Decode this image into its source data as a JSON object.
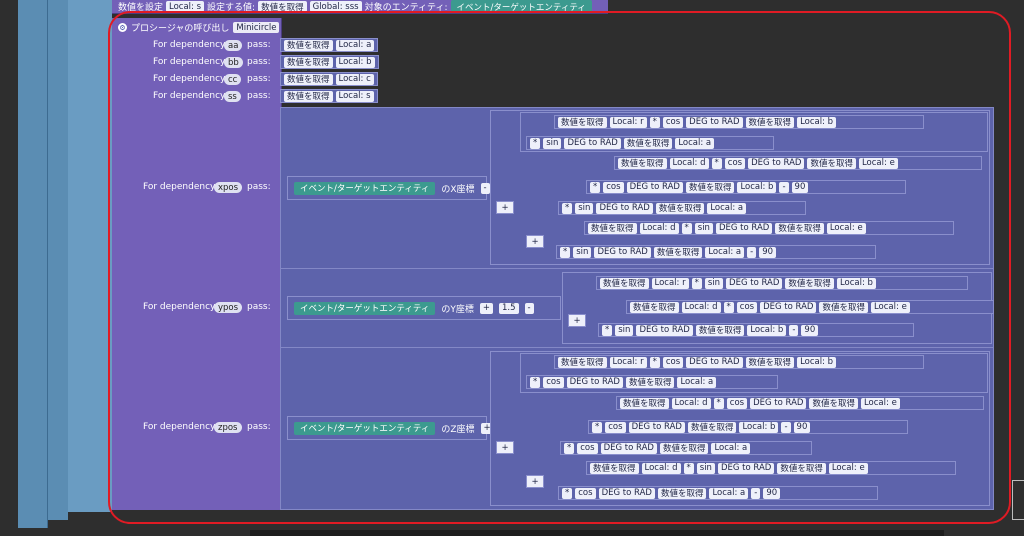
{
  "top_block": [
    "数値を設定",
    "Local: s",
    "設定する値:",
    "数値を取得",
    "Global: sss",
    "対象のエンティティ:",
    "イベント/ターゲットエンティティ"
  ],
  "procedure": {
    "label": "プロシージャの呼び出し",
    "name": "Minicircle",
    "for": "For dependency",
    "pass": "pass:"
  },
  "deps": [
    {
      "name": "aa",
      "get": "数値を取得",
      "local": "Local: a"
    },
    {
      "name": "bb",
      "get": "数値を取得",
      "local": "Local: b"
    },
    {
      "name": "cc",
      "get": "数値を取得",
      "local": "Local: c"
    },
    {
      "name": "ss",
      "get": "数値を取得",
      "local": "Local: s"
    }
  ],
  "big": {
    "xpos": "xpos",
    "ypos": "ypos",
    "zpos": "zpos"
  },
  "entity": "イベント/ターゲットエンティティ",
  "coord": {
    "x": "のX座標",
    "y": "のY座標",
    "z": "のZ座標"
  },
  "t": {
    "get": "数値を取得",
    "cos": "cos",
    "sin": "sin",
    "deg": "DEG to RAD",
    "mul": "*",
    "plus": "+",
    "minus": "-"
  },
  "loc": {
    "r": "Local: r",
    "a": "Local: a",
    "b": "Local: b",
    "d": "Local: d",
    "e": "Local: e"
  },
  "num": {
    "n90": "90",
    "n15": "1.5"
  }
}
